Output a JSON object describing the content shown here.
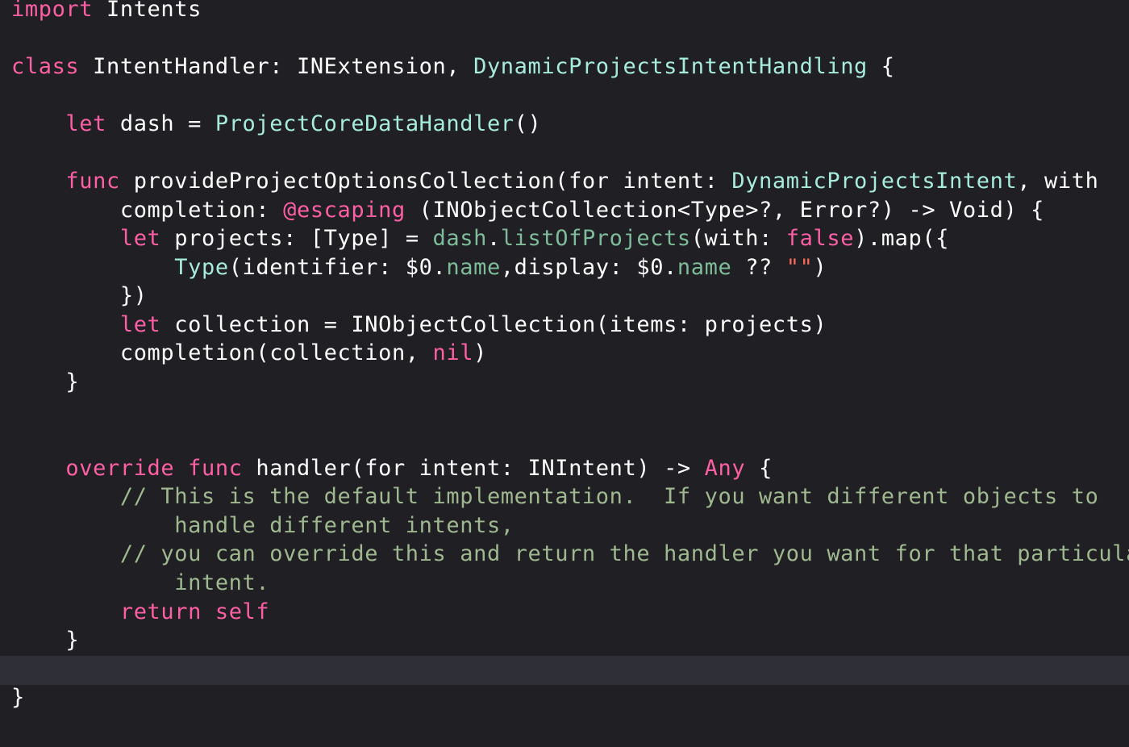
{
  "colors": {
    "background": "#1f1f24",
    "current_line": "#2f3037",
    "keyword": "#fc5fa3",
    "plain": "#ffffff",
    "project_type": "#a7ebdd",
    "project_method": "#7ebc9a",
    "comment": "#9fb88f",
    "string": "#fc6a5d"
  },
  "lines": [
    {
      "tokens": [
        {
          "text": "import",
          "kind": "kw"
        },
        {
          "text": " Intents",
          "kind": "plain"
        }
      ]
    },
    {
      "tokens": []
    },
    {
      "tokens": [
        {
          "text": "class",
          "kind": "kw"
        },
        {
          "text": " IntentHandler: INExtension, ",
          "kind": "plain"
        },
        {
          "text": "DynamicProjectsIntentHandling",
          "kind": "type-green"
        },
        {
          "text": " {",
          "kind": "plain"
        }
      ]
    },
    {
      "tokens": []
    },
    {
      "tokens": [
        {
          "text": "    ",
          "kind": "plain"
        },
        {
          "text": "let",
          "kind": "kw"
        },
        {
          "text": " dash = ",
          "kind": "plain"
        },
        {
          "text": "ProjectCoreDataHandler",
          "kind": "type-green"
        },
        {
          "text": "()",
          "kind": "plain"
        }
      ]
    },
    {
      "tokens": []
    },
    {
      "tokens": [
        {
          "text": "    ",
          "kind": "plain"
        },
        {
          "text": "func",
          "kind": "kw"
        },
        {
          "text": " provideProjectOptionsCollection(for intent: ",
          "kind": "plain"
        },
        {
          "text": "DynamicProjectsIntent",
          "kind": "type-green"
        },
        {
          "text": ", with",
          "kind": "plain"
        }
      ]
    },
    {
      "tokens": [
        {
          "text": "        completion: ",
          "kind": "plain"
        },
        {
          "text": "@escaping",
          "kind": "kw"
        },
        {
          "text": " (INObjectCollection<Type>?, Error?) -> Void) {",
          "kind": "plain"
        }
      ]
    },
    {
      "tokens": [
        {
          "text": "        ",
          "kind": "plain"
        },
        {
          "text": "let",
          "kind": "kw"
        },
        {
          "text": " projects: [Type] = ",
          "kind": "plain"
        },
        {
          "text": "dash",
          "kind": "method-green"
        },
        {
          "text": ".",
          "kind": "plain"
        },
        {
          "text": "listOfProjects",
          "kind": "method-green"
        },
        {
          "text": "(with: ",
          "kind": "plain"
        },
        {
          "text": "false",
          "kind": "kw"
        },
        {
          "text": ").map({",
          "kind": "plain"
        }
      ]
    },
    {
      "tokens": [
        {
          "text": "            ",
          "kind": "plain"
        },
        {
          "text": "Type",
          "kind": "type-green"
        },
        {
          "text": "(identifier: $0.",
          "kind": "plain"
        },
        {
          "text": "name",
          "kind": "method-green"
        },
        {
          "text": ",display: $0.",
          "kind": "plain"
        },
        {
          "text": "name",
          "kind": "method-green"
        },
        {
          "text": " ?? ",
          "kind": "plain"
        },
        {
          "text": "\"\"",
          "kind": "string"
        },
        {
          "text": ")",
          "kind": "plain"
        }
      ]
    },
    {
      "tokens": [
        {
          "text": "        })",
          "kind": "plain"
        }
      ]
    },
    {
      "tokens": [
        {
          "text": "        ",
          "kind": "plain"
        },
        {
          "text": "let",
          "kind": "kw"
        },
        {
          "text": " collection = INObjectCollection(items: projects)",
          "kind": "plain"
        }
      ]
    },
    {
      "tokens": [
        {
          "text": "        completion(collection, ",
          "kind": "plain"
        },
        {
          "text": "nil",
          "kind": "kw"
        },
        {
          "text": ")",
          "kind": "plain"
        }
      ]
    },
    {
      "tokens": [
        {
          "text": "    }",
          "kind": "plain"
        }
      ]
    },
    {
      "tokens": []
    },
    {
      "tokens": []
    },
    {
      "tokens": [
        {
          "text": "    ",
          "kind": "plain"
        },
        {
          "text": "override",
          "kind": "kw"
        },
        {
          "text": " ",
          "kind": "plain"
        },
        {
          "text": "func",
          "kind": "kw"
        },
        {
          "text": " handler(for intent: INIntent) -> ",
          "kind": "plain"
        },
        {
          "text": "Any",
          "kind": "kw"
        },
        {
          "text": " {",
          "kind": "plain"
        }
      ]
    },
    {
      "tokens": [
        {
          "text": "        ",
          "kind": "plain"
        },
        {
          "text": "// This is the default implementation.  If you want different objects to",
          "kind": "comment-green"
        }
      ]
    },
    {
      "tokens": [
        {
          "text": "            ",
          "kind": "plain"
        },
        {
          "text": "handle different intents,",
          "kind": "comment-green"
        }
      ]
    },
    {
      "tokens": [
        {
          "text": "        ",
          "kind": "plain"
        },
        {
          "text": "// you can override this and return the handler you want for that particular",
          "kind": "comment-green"
        }
      ]
    },
    {
      "tokens": [
        {
          "text": "            ",
          "kind": "plain"
        },
        {
          "text": "intent.",
          "kind": "comment-green"
        }
      ]
    },
    {
      "tokens": [
        {
          "text": "        ",
          "kind": "plain"
        },
        {
          "text": "return",
          "kind": "kw"
        },
        {
          "text": " ",
          "kind": "plain"
        },
        {
          "text": "self",
          "kind": "kw"
        }
      ]
    },
    {
      "tokens": [
        {
          "text": "    }",
          "kind": "plain"
        }
      ]
    },
    {
      "tokens": []
    },
    {
      "tokens": [
        {
          "text": "}",
          "kind": "plain"
        }
      ]
    }
  ]
}
